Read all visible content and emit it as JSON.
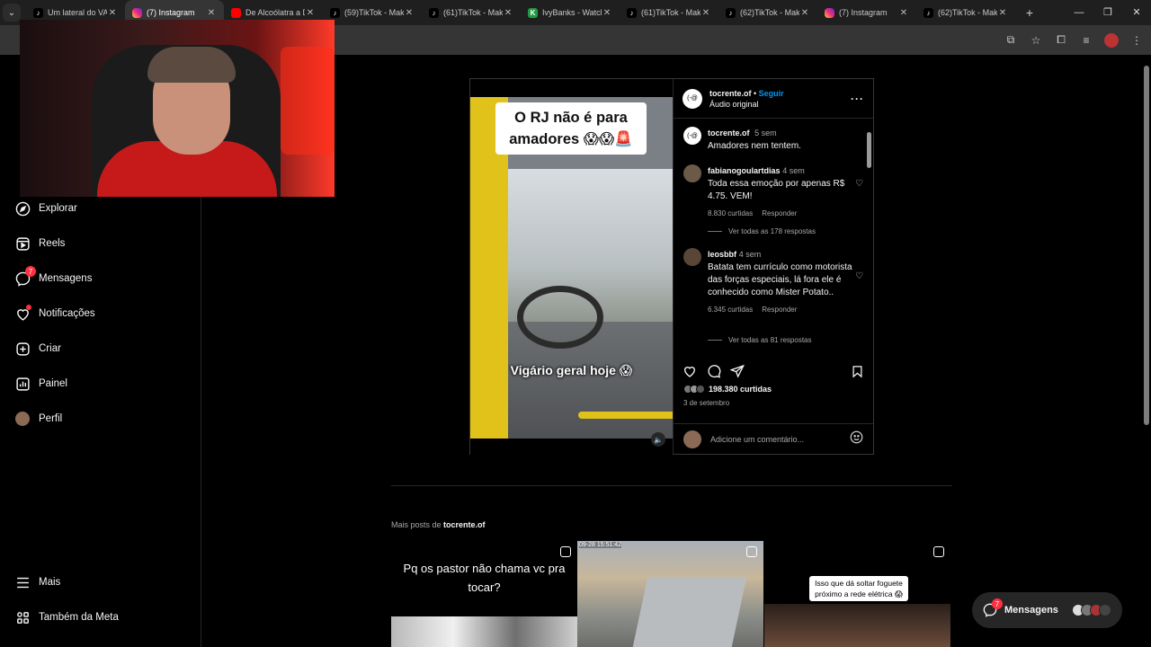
{
  "browser": {
    "tabs": [
      {
        "title": "Um lateral do VAS",
        "favicon": "tiktok-icon",
        "active": false
      },
      {
        "title": "(7) Instagram",
        "favicon": "instagram-icon",
        "active": true
      },
      {
        "title": "De Alcoólatra a D",
        "favicon": "youtube-icon",
        "active": false
      },
      {
        "title": "(59)TikTok - Make",
        "favicon": "tiktok-icon",
        "active": false
      },
      {
        "title": "(61)TikTok - Make",
        "favicon": "tiktok-icon",
        "active": false
      },
      {
        "title": "IvyBanks - Watch",
        "favicon": "ivybanks-icon",
        "active": false
      },
      {
        "title": "(61)TikTok - Make",
        "favicon": "tiktok-icon",
        "active": false
      },
      {
        "title": "(62)TikTok - Make",
        "favicon": "tiktok-icon",
        "active": false
      },
      {
        "title": "(7) Instagram",
        "favicon": "instagram-icon",
        "active": false
      },
      {
        "title": "(62)TikTok - Make",
        "favicon": "tiktok-icon",
        "active": false
      }
    ]
  },
  "sidebar": {
    "items": [
      {
        "label": "Explorar",
        "icon": "compass-icon"
      },
      {
        "label": "Reels",
        "icon": "reels-icon"
      },
      {
        "label": "Mensagens",
        "icon": "messenger-icon",
        "badge": "7"
      },
      {
        "label": "Notificações",
        "icon": "heart-icon",
        "dot": true
      },
      {
        "label": "Criar",
        "icon": "plus-square-icon"
      },
      {
        "label": "Painel",
        "icon": "dashboard-icon"
      },
      {
        "label": "Perfil",
        "icon": "avatar"
      }
    ],
    "bottom": [
      {
        "label": "Mais",
        "icon": "menu-icon"
      },
      {
        "label": "Também da Meta",
        "icon": "meta-grid-icon"
      }
    ]
  },
  "post": {
    "username": "tocrente.of",
    "follow_label": "Seguir",
    "audio": "Áudio original",
    "video_caption_top": "O RJ não é para amadores 😱😱🚨",
    "video_caption_mid": "Vigário geral hoje 😱",
    "caption": {
      "user": "tocrente.of",
      "time": "5 sem",
      "text": "Amadores nem tentem."
    },
    "comments": [
      {
        "user": "fabianogoulartdias",
        "time": "4 sem",
        "text": "Toda essa emoção por apenas R$ 4.75. VEM!",
        "likes": "8.830 curtidas",
        "reply": "Responder",
        "view_replies": "Ver todas as 178 respostas"
      },
      {
        "user": "leosbbf",
        "time": "4 sem",
        "text": "Batata tem currículo como motorista das forças especiais, lá fora ele é conhecido como Mister Potato..",
        "likes": "6.345 curtidas",
        "reply": "Responder",
        "view_replies": "Ver todas as 81 respostas"
      }
    ],
    "likes_count": "198.380 curtidas",
    "date": "3 de setembro",
    "comment_placeholder": "Adicione um comentário..."
  },
  "more_posts": {
    "label_prefix": "Mais posts de",
    "label_user": "tocrente.of",
    "items": [
      {
        "caption": "Pq os pastor não chama vc pra tocar?"
      },
      {
        "timestamp": "09-28 15:51:42"
      },
      {
        "caption": "Isso que dá soltar foguete próximo a rede elétrica 😱"
      }
    ]
  },
  "messages_pill": {
    "label": "Mensagens",
    "badge": "7"
  },
  "colors": {
    "accent": "#0095f6",
    "notification": "#ff3040"
  }
}
